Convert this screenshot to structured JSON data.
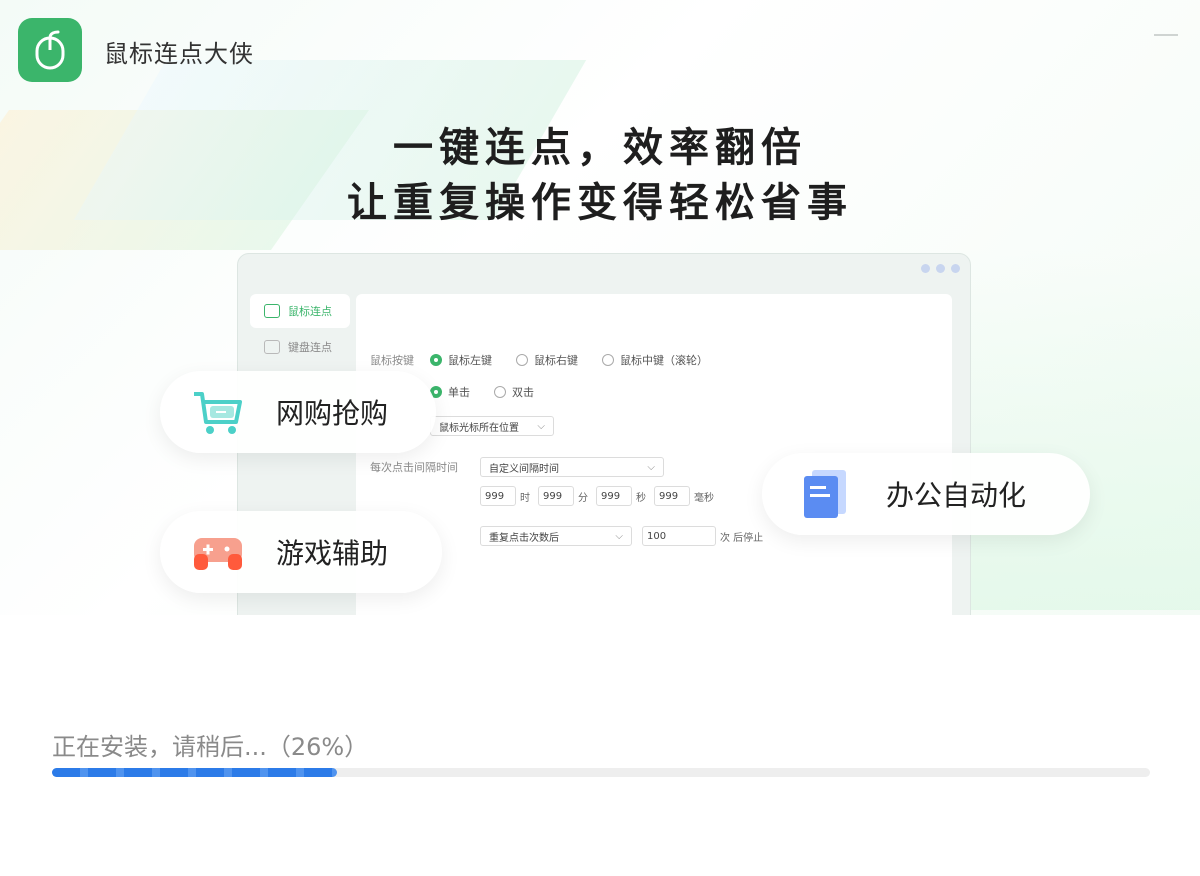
{
  "app": {
    "title": "鼠标连点大侠"
  },
  "headline": {
    "line1": "一键连点，效率翻倍",
    "line2": "让重复操作变得轻松省事"
  },
  "mock": {
    "sidebar": [
      {
        "label": "鼠标连点",
        "active": true
      },
      {
        "label": "键盘连点",
        "active": false
      }
    ],
    "form": {
      "mouse_button_label": "鼠标按键",
      "mouse_button_options": [
        "鼠标左键",
        "鼠标右键",
        "鼠标中键（滚轮）"
      ],
      "click_type_options": [
        "单击",
        "双击"
      ],
      "position_select": "鼠标光标所在位置",
      "interval_label": "每次点击间隔时间",
      "interval_select": "自定义间隔时间",
      "time_values": [
        "999",
        "999",
        "999",
        "999"
      ],
      "time_units": [
        "时",
        "分",
        "秒",
        "毫秒"
      ],
      "stop_select": "重复点击次数后",
      "stop_count": "100",
      "stop_suffix": "次 后停止"
    }
  },
  "features": {
    "shop": "网购抢购",
    "game": "游戏辅助",
    "office": "办公自动化"
  },
  "progress": {
    "text": "正在安装，请稍后...（26%）",
    "percent": 26
  },
  "colors": {
    "brand": "#3bb56b",
    "progress": "#2c7be8"
  },
  "icons": [
    "mouse-icon",
    "minimize-icon",
    "cart-icon",
    "gamepad-icon",
    "document-icon",
    "cursor-click-icon",
    "keyboard-icon"
  ]
}
